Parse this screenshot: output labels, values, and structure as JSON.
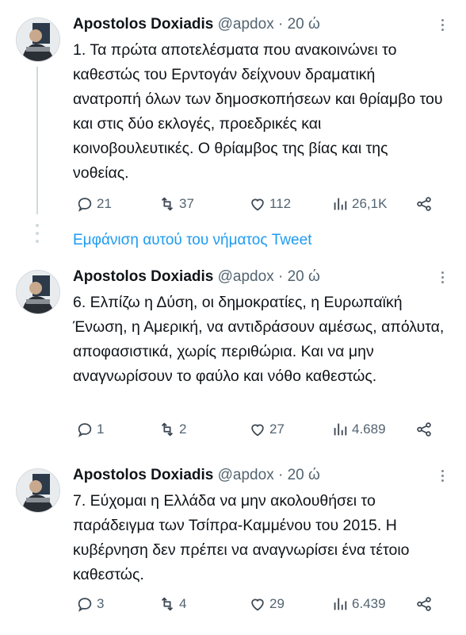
{
  "tweets": [
    {
      "name": "Apostolos Doxiadis",
      "meta": "@apdox · 20 ώ",
      "text": "1. Τα πρώτα αποτελέσματα που ανακοινώνει το καθεστώς του Ερντογάν δείχνουν δραματική ανατροπή όλων των δημοσκοπήσεων και θρίαμβο του και στις δύο εκλογές, προεδρικές και κοινοβουλευτικές. Ο θρίαμβος της βίας και της νοθείας.",
      "replies": "21",
      "retweets": "37",
      "likes": "112",
      "views": "26,1K"
    },
    {
      "name": "Apostolos Doxiadis",
      "meta": "@apdox · 20 ώ",
      "text": "6. Ελπίζω η Δύση, οι δημοκρατίες, η Ευρωπαϊκή Ένωση, η Αμερική, να αντιδράσουν αμέσως, απόλυτα, αποφασιστικά, χωρίς περιθώρια. Και να μην αναγνωρίσουν το φαύλο και νόθο καθεστώς.",
      "replies": "1",
      "retweets": "2",
      "likes": "27",
      "views": "4.689"
    },
    {
      "name": "Apostolos Doxiadis",
      "meta": "@apdox · 20 ώ",
      "text": "7. Εύχομαι η Ελλάδα να μην ακολουθήσει το παράδειγμα των Τσίπρα-Καμμένου του 2015. Η κυβέρνηση δεν πρέπει να αναγνωρίσει ένα τέτοιο καθεστώς.",
      "replies": "3",
      "retweets": "4",
      "likes": "29",
      "views": "6.439"
    }
  ],
  "show_thread_label": "Εμφάνιση αυτού του νήματος Tweet",
  "colors": {
    "accent": "#1d9bf0",
    "text": "#0f1419",
    "muted": "#536471",
    "line": "#cfd9de"
  },
  "icons": [
    "reply-icon",
    "retweet-icon",
    "like-icon",
    "views-icon",
    "share-icon",
    "more-icon"
  ]
}
